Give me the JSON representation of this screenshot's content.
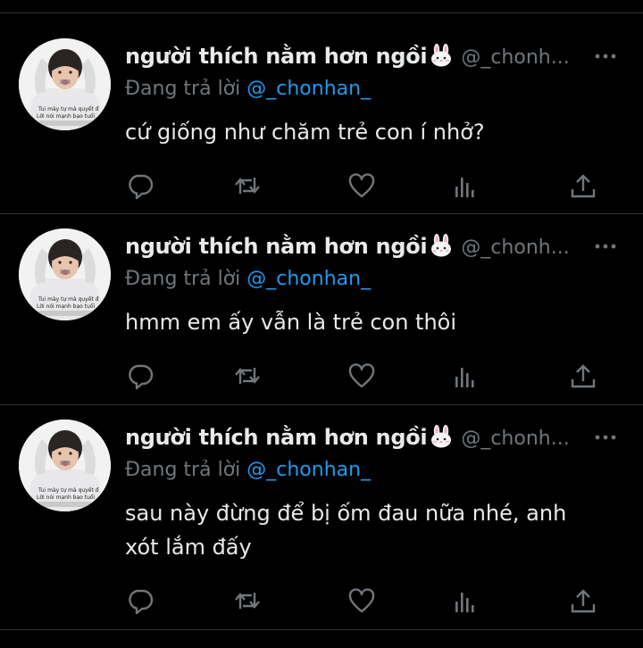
{
  "colors": {
    "background": "#000000",
    "text": "#e7e9ea",
    "muted": "#71767b",
    "accent": "#1d9bf0",
    "divider": "#2f3336"
  },
  "tweets": [
    {
      "display_name": "người thích nằm hơn ngồi",
      "name_emoji": "bunny-face-icon",
      "handle": "@_chonh...",
      "replying_prefix": "Đang trả lời",
      "replying_to": "@_chonhan_",
      "text": "cứ giống như chăm trẻ con í nhở?",
      "avatar_caption_1": "Tui mày tự mà quyết đ",
      "avatar_caption_2": "Lời nói mạnh bạo tuổi"
    },
    {
      "display_name": "người thích nằm hơn ngồi",
      "name_emoji": "bunny-face-icon",
      "handle": "@_chonh...",
      "replying_prefix": "Đang trả lời",
      "replying_to": "@_chonhan_",
      "text": "hmm em ấy vẫn là trẻ con thôi",
      "avatar_caption_1": "Tui mày tự mà quyết đ",
      "avatar_caption_2": "Lời nói mạnh bạo tuổi"
    },
    {
      "display_name": "người thích nằm hơn ngồi",
      "name_emoji": "bunny-face-icon",
      "handle": "@_chonh...",
      "replying_prefix": "Đang trả lời",
      "replying_to": "@_chonhan_",
      "text": "sau này đừng để bị ốm đau nữa nhé, anh xót lắm đấy",
      "avatar_caption_1": "Tui mày tự mà quyết đ",
      "avatar_caption_2": "Lời nói mạnh bạo tuổi"
    }
  ],
  "action_icons": [
    "reply-icon",
    "retweet-icon",
    "like-icon",
    "views-icon",
    "share-icon"
  ]
}
